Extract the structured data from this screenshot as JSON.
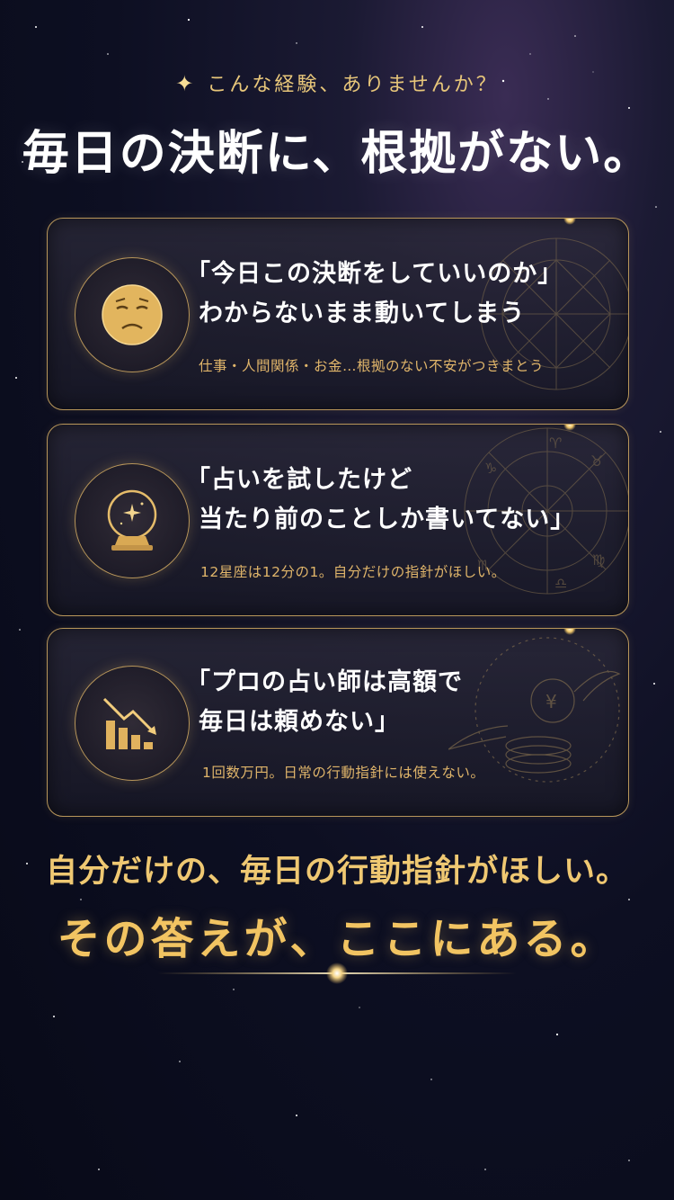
{
  "header": {
    "eyebrow": "こんな経験、ありませんか？",
    "headline": "毎日の決断に、根拠がない。"
  },
  "cards": [
    {
      "icon": "worried-face-icon",
      "quote_line1": "「今日この決断をしていいのか」",
      "quote_line2": "わからないまま動いてしまう",
      "note": "仕事・人間関係・お金…根拠のない不安がつきまとう"
    },
    {
      "icon": "crystal-ball-icon",
      "quote_line1": "「占いを試したけど",
      "quote_line2": "当たり前のことしか書いてない」",
      "note": "12星座は12分の1。自分だけの指針がほしい。"
    },
    {
      "icon": "declining-chart-icon",
      "quote_line1": "「プロの占い師は高額で",
      "quote_line2": "毎日は頼めない」",
      "note": "1回数万円。日常の行動指針には使えない。"
    }
  ],
  "closing": {
    "line1": "自分だけの、毎日の行動指針がほしい。",
    "line2": "その答えが、ここにある。"
  },
  "colors": {
    "gold": "#e7c67a",
    "gold_deep": "#b8965a",
    "background": "#0d0f22"
  }
}
